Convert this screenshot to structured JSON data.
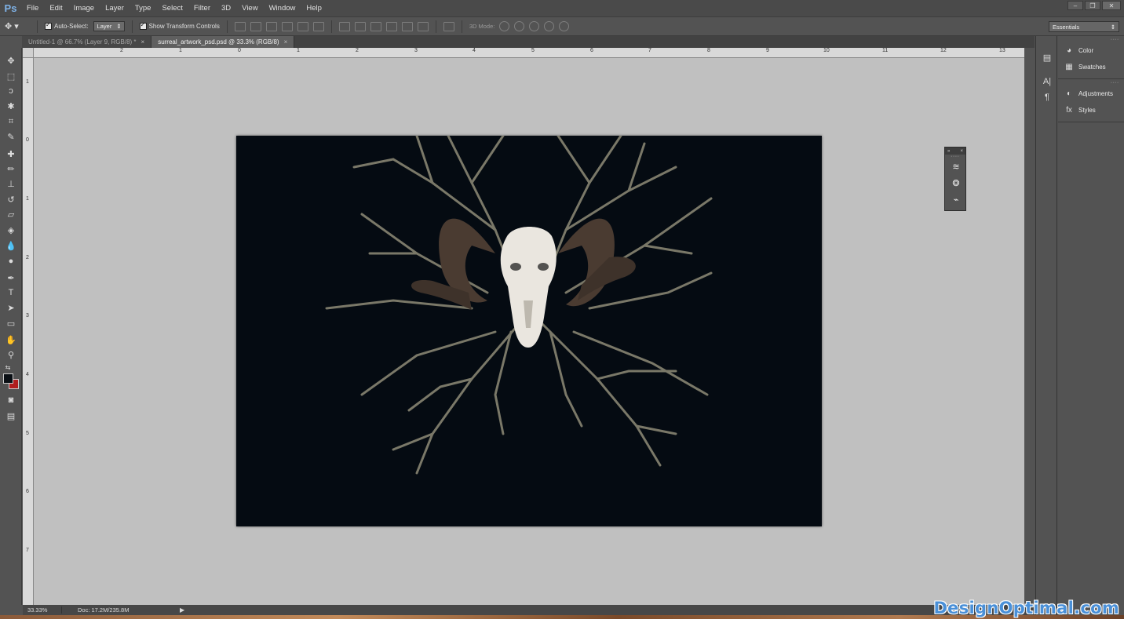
{
  "app": {
    "logo": "Ps"
  },
  "menu": [
    "File",
    "Edit",
    "Image",
    "Layer",
    "Type",
    "Select",
    "Filter",
    "3D",
    "View",
    "Window",
    "Help"
  ],
  "window_controls": {
    "minimize": "–",
    "restore": "❐",
    "close": "✕"
  },
  "options": {
    "auto_select_label": "Auto-Select:",
    "auto_select_target": "Layer",
    "show_transform_label": "Show Transform Controls",
    "mode_3d_label": "3D Mode:",
    "workspace": "Essentials"
  },
  "tabs": [
    {
      "label": "Untitled-1 @ 66.7% (Layer 9, RGB/8) *",
      "active": false
    },
    {
      "label": "surreal_artwork_psd.psd @ 33.3% (RGB/8)",
      "active": true
    }
  ],
  "tab_close": "×",
  "ruler_h": [
    "2",
    "1",
    "0",
    "1",
    "2",
    "3",
    "4",
    "5",
    "6",
    "7",
    "8",
    "9",
    "10",
    "11",
    "12",
    "13"
  ],
  "ruler_v": [
    "1",
    "0",
    "1",
    "2",
    "3",
    "4",
    "5",
    "6",
    "7"
  ],
  "status": {
    "zoom": "33.33%",
    "doc": "Doc: 17.2M/235.8M",
    "arrow": "▶"
  },
  "float_panel": {
    "expand": "»",
    "close": "×"
  },
  "right_panels": [
    {
      "label": "Color",
      "icon": "color-icon"
    },
    {
      "label": "Swatches",
      "icon": "swatches-icon"
    },
    {
      "label": "Adjustments",
      "icon": "adjustments-icon"
    },
    {
      "label": "Styles",
      "icon": "styles-icon"
    }
  ],
  "colors": {
    "foreground": "#0a0f14",
    "background": "#b01e1e",
    "document_bg": "#050b12"
  },
  "watermark": "DesignOptimal.com"
}
